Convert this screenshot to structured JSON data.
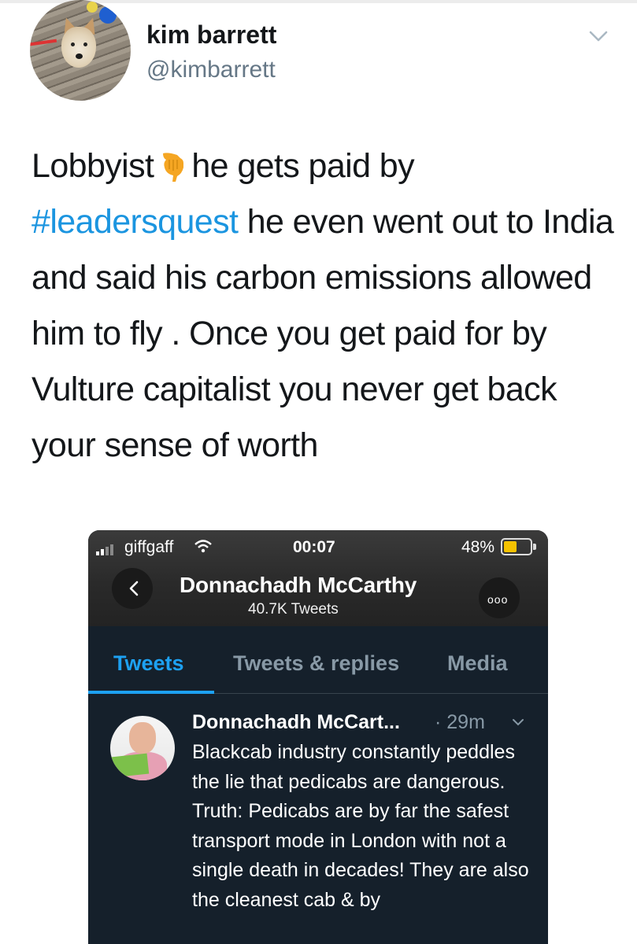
{
  "author": {
    "display_name": "kim barrett",
    "handle": "@kimbarrett"
  },
  "tweet": {
    "line1_before_emoji": "Lobbyist",
    "emoji": "pointing-down-hand-emoji",
    "line1_after_emoji": "he gets paid by",
    "hashtag": "#leadersquest",
    "after_hashtag": " he even went out to India  and said his carbon emissions allowed him to fly . Once you get paid for by Vulture capitalist you never get back  your sense of worth"
  },
  "embedded_screenshot": {
    "status_bar": {
      "carrier": "giffgaff",
      "time": "00:07",
      "battery": "48%"
    },
    "profile": {
      "name": "Donnachadh McCarthy",
      "tweet_count": "40.7K Tweets"
    },
    "tabs": [
      {
        "label": "Tweets",
        "active": true
      },
      {
        "label": "Tweets & replies",
        "active": false
      },
      {
        "label": "Media",
        "active": false
      }
    ],
    "inner_tweet": {
      "name": "Donnachadh McCart...",
      "time": "· 29m",
      "text": "Blackcab industry constantly peddles the lie that pedicabs are dangerous. Truth: Pedicabs are by far the safest transport mode in London with not a single death in decades! They are also the cleanest cab & by"
    }
  },
  "colors": {
    "hashtag_blue": "#1b95e0",
    "dark_bg": "#15202b",
    "accent": "#1da1f2",
    "secondary_text": "#657786",
    "battery_yellow": "#f5c200"
  }
}
